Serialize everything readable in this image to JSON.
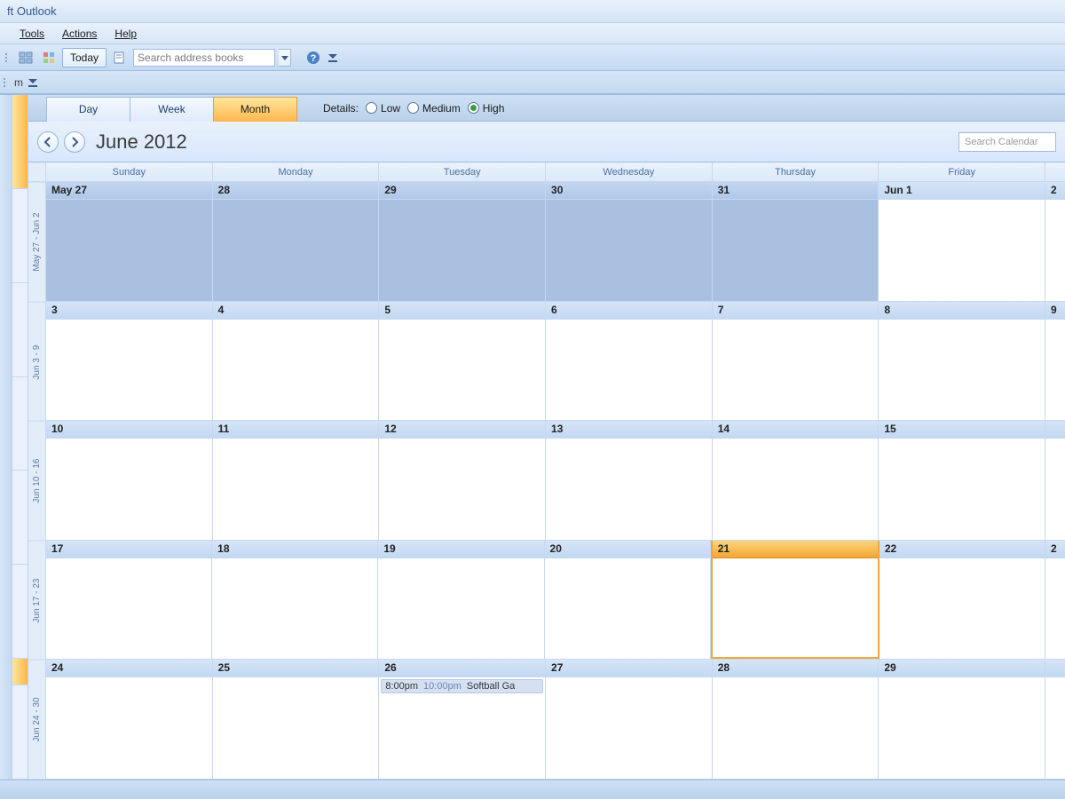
{
  "title": "ft Outlook",
  "menu": [
    "Tools",
    "Actions",
    "Help"
  ],
  "toolbar": {
    "today": "Today",
    "search_books": "Search address books"
  },
  "toolbar2": {
    "label": "m"
  },
  "view_switch": {
    "day": "Day",
    "week": "Week",
    "month": "Month",
    "active": "month"
  },
  "details": {
    "label": "Details:",
    "low": "Low",
    "medium": "Medium",
    "high": "High",
    "selected": "high"
  },
  "month_header": "June 2012",
  "search_calendar_placeholder": "Search Calendar",
  "dow": [
    "Sunday",
    "Monday",
    "Tuesday",
    "Wednesday",
    "Thursday",
    "Friday",
    ""
  ],
  "week_labels": [
    "May 27 - Jun 2",
    "Jun 3 - 9",
    "Jun 10 - 16",
    "Jun 17 - 23",
    "Jun 24 - 30"
  ],
  "weeks": [
    [
      {
        "label": "May 27",
        "other": true
      },
      {
        "label": "28",
        "other": true
      },
      {
        "label": "29",
        "other": true
      },
      {
        "label": "30",
        "other": true
      },
      {
        "label": "31",
        "other": true
      },
      {
        "label": "Jun 1"
      },
      {
        "label": "2"
      }
    ],
    [
      {
        "label": "3"
      },
      {
        "label": "4"
      },
      {
        "label": "5"
      },
      {
        "label": "6"
      },
      {
        "label": "7"
      },
      {
        "label": "8"
      },
      {
        "label": "9"
      }
    ],
    [
      {
        "label": "10"
      },
      {
        "label": "11"
      },
      {
        "label": "12"
      },
      {
        "label": "13"
      },
      {
        "label": "14"
      },
      {
        "label": "15"
      },
      {
        "label": ""
      }
    ],
    [
      {
        "label": "17"
      },
      {
        "label": "18"
      },
      {
        "label": "19"
      },
      {
        "label": "20"
      },
      {
        "label": "21",
        "today": true
      },
      {
        "label": "22"
      },
      {
        "label": "2"
      }
    ],
    [
      {
        "label": "24"
      },
      {
        "label": "25"
      },
      {
        "label": "26",
        "event": {
          "start": "8:00pm",
          "end": "10:00pm",
          "title": "Softball Ga"
        }
      },
      {
        "label": "27"
      },
      {
        "label": "28"
      },
      {
        "label": "29"
      },
      {
        "label": ""
      }
    ]
  ]
}
